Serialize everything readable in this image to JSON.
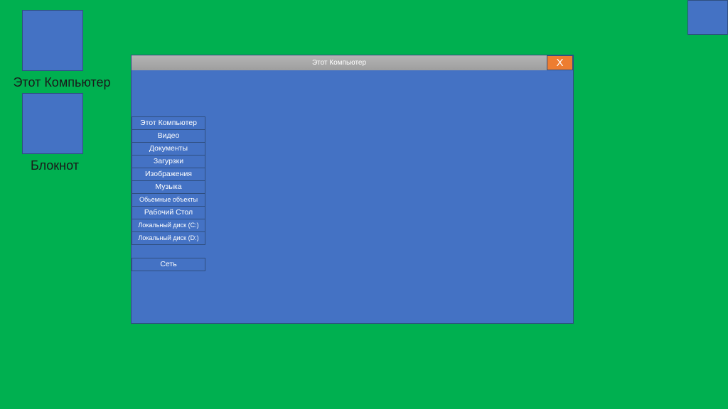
{
  "desktop": {
    "background": "#00b050",
    "icons": [
      {
        "label": "Этот Компьютер",
        "icon": "computer-icon"
      },
      {
        "label": "Блокнот",
        "icon": "notepad-icon"
      }
    ]
  },
  "window": {
    "title": "Этот Компьютер",
    "close_label": "X",
    "accent": "#4472c4",
    "close_color": "#ed7d31",
    "nav": [
      "Этот Компьютер",
      "Видео",
      "Документы",
      "Загурзки",
      "Изображения",
      "Музыка",
      "Обьемные объекты",
      "Рабочий Стол",
      "Локальный диск (C:)",
      "Локальный диск (D:)",
      "Сеть"
    ]
  }
}
